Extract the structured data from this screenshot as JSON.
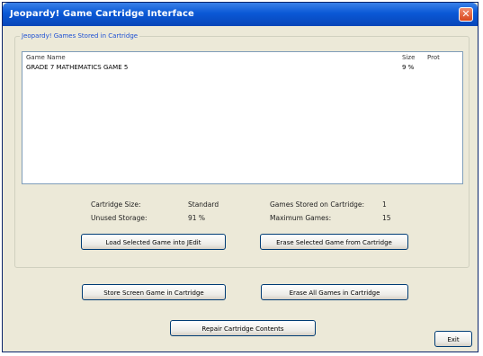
{
  "window": {
    "title": "Jeopardy! Game Cartridge Interface",
    "close_symbol": "✕"
  },
  "group": {
    "label": "Jeopardy! Games Stored in Cartridge"
  },
  "list": {
    "columns": [
      "Game Name",
      "Size",
      "Prot"
    ],
    "rows": [
      {
        "name": "GRADE 7 MATHEMATICS GAME 5",
        "size": "9 %",
        "prot": ""
      }
    ]
  },
  "info": {
    "cartridge_size_label": "Cartridge Size:",
    "cartridge_size_value": "Standard",
    "unused_storage_label": "Unused Storage:",
    "unused_storage_value": "91 %",
    "games_stored_label": "Games Stored on Cartridge:",
    "games_stored_value": "1",
    "maximum_games_label": "Maximum Games:",
    "maximum_games_value": "15"
  },
  "buttons": {
    "load": "Load Selected Game into JEdit",
    "erase_selected": "Erase Selected Game from Cartridge",
    "store": "Store Screen Game in Cartridge",
    "erase_all": "Erase All Games in Cartridge",
    "repair": "Repair Cartridge Contents",
    "exit": "Exit"
  }
}
